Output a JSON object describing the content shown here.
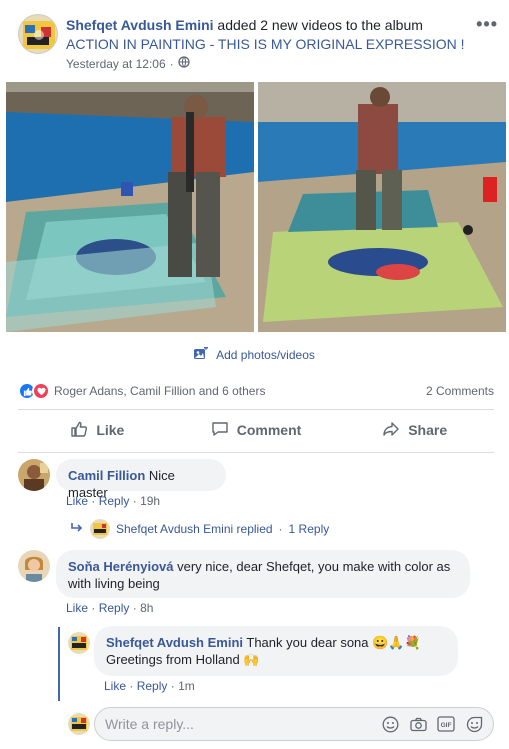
{
  "post": {
    "author": "Shefqet Avdush Emini",
    "action_text": " added 2 new videos to the album ",
    "album": "ACTION IN PAINTING - THIS IS MY ORIGINAL EXPRESSION !",
    "timestamp": "Yesterday at 12:06",
    "more_label": "•••",
    "audience_icon": "globe-icon"
  },
  "add_photos_label": "Add photos/videos",
  "reactions": {
    "summary": "Roger Adans, Camil Fillion and 6 others",
    "comments_count": "2 Comments"
  },
  "actions": {
    "like": "Like",
    "comment": "Comment",
    "share": "Share"
  },
  "comments": [
    {
      "author": "Camil Fillion",
      "text": " Nice master",
      "like": "Like",
      "reply": "Reply",
      "time": "19h",
      "replied_by": "Shefqet Avdush Emini replied",
      "reply_count": "1 Reply"
    },
    {
      "author": "Soňa Herényiová",
      "text": " very nice, dear Shefqet, you make with color as with living being",
      "like": "Like",
      "reply": "Reply",
      "time": "8h",
      "reply_item": {
        "author": "Shefqet Avdush Emini",
        "text": " Thank you dear sona 😀🙏💐 Greetings from Holland 🙌",
        "like": "Like",
        "reply": "Reply",
        "time": "1m"
      }
    }
  ],
  "write_reply": {
    "placeholder": "Write a reply..."
  },
  "colors": {
    "link": "#385898",
    "like_blue": "#1877f2",
    "love_red": "#f33e58",
    "thread_line": "#4267b2"
  }
}
